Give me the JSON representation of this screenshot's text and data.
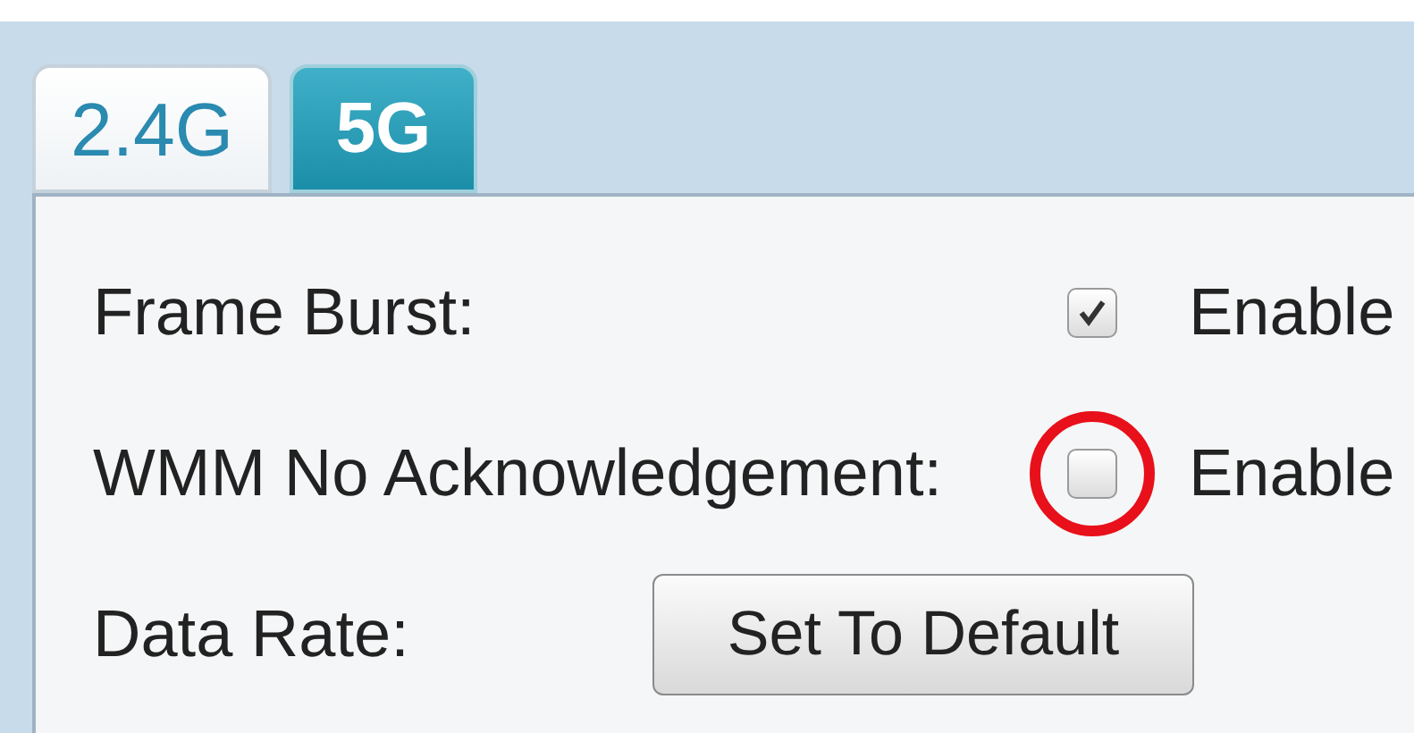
{
  "tabs": [
    {
      "label": "2.4G",
      "selected": false
    },
    {
      "label": "5G",
      "selected": true
    }
  ],
  "rows": [
    {
      "kind": "checkbox",
      "label": "Frame Burst:",
      "checked": true,
      "option": "Enable",
      "highlighted": false
    },
    {
      "kind": "checkbox",
      "label": "WMM No Acknowledgement:",
      "checked": false,
      "option": "Enable",
      "highlighted": true
    },
    {
      "kind": "button",
      "label": "Data Rate:",
      "button": "Set To Default"
    }
  ]
}
